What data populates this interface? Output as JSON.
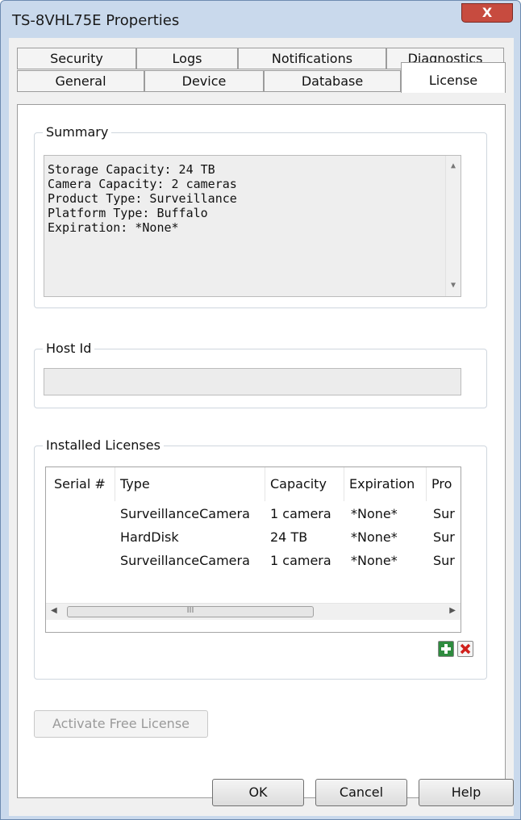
{
  "window": {
    "title": "TS-8VHL75E Properties",
    "close_glyph": "X"
  },
  "tabs": {
    "back_row": [
      "Security",
      "Logs",
      "Notifications",
      "Diagnostics"
    ],
    "front_row": [
      "General",
      "Device",
      "Database",
      "License"
    ],
    "active": "License"
  },
  "summary": {
    "label": "Summary",
    "lines": [
      "Storage Capacity: 24 TB",
      "Camera Capacity: 2 cameras",
      "Product Type: Surveillance",
      "Platform Type: Buffalo",
      "Expiration: *None*"
    ]
  },
  "host_id": {
    "label": "Host Id",
    "value": ""
  },
  "installed_licenses": {
    "label": "Installed Licenses",
    "columns": [
      "Serial #",
      "Type",
      "Capacity",
      "Expiration",
      "Pro"
    ],
    "rows": [
      [
        "",
        "SurveillanceCamera",
        "1 camera",
        "*None*",
        "Sur"
      ],
      [
        "",
        "HardDisk",
        "24 TB",
        "*None*",
        "Sur"
      ],
      [
        "",
        "SurveillanceCamera",
        "1 camera",
        "*None*",
        "Sur"
      ]
    ],
    "scroll_thumb_glyph": "III",
    "add_icon": "plus-icon",
    "remove_icon": "x-icon"
  },
  "buttons": {
    "activate_free_license": "Activate Free License",
    "ok": "OK",
    "cancel": "Cancel",
    "help": "Help"
  },
  "colors": {
    "add_green": "#2e8b3e",
    "remove_red": "#d0201b",
    "close_red": "#c74b3f"
  }
}
